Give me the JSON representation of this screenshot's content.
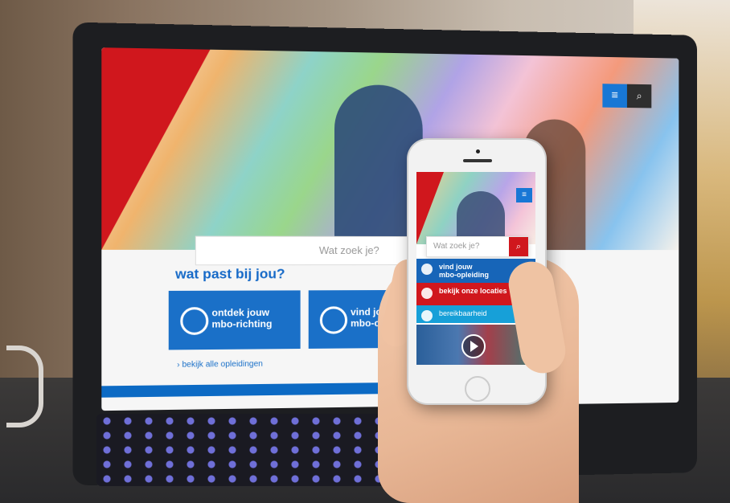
{
  "laptop_site": {
    "search_placeholder": "Wat zoek je?",
    "heading": "wat past bij jou?",
    "card1": "ontdek jouw\nmbo-richting",
    "card2": "vind jouw\nmbo-opleiding",
    "small_link": "› bekijk alle opleidingen"
  },
  "phone_site": {
    "search_placeholder": "Wat zoek je?",
    "items": [
      {
        "label": "vind jouw\nmbo-opleiding",
        "color": "#1765b8"
      },
      {
        "label": "bekijk onze locaties",
        "color": "#d0171d"
      },
      {
        "label": "bereikbaarheid",
        "color": "#17a0d8"
      }
    ]
  },
  "icons": [
    "menu-icon",
    "search-icon",
    "play-icon"
  ]
}
